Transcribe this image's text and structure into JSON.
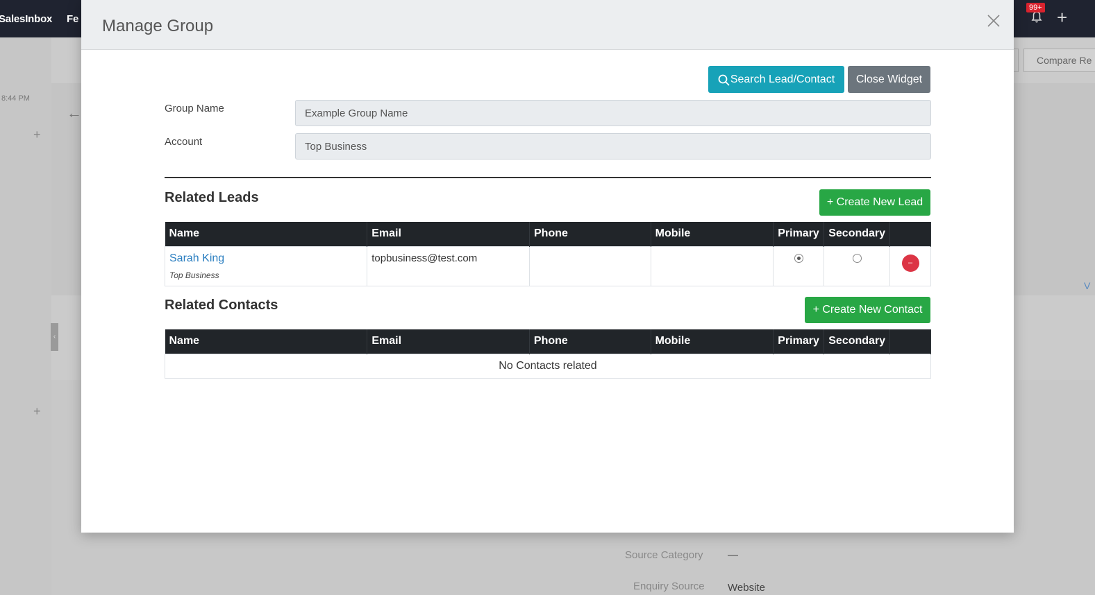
{
  "app": {
    "nav": [
      "SalesInbox",
      "Fe"
    ],
    "notification_badge": "99+",
    "background": {
      "time": "8:44 PM",
      "compare_button": "Compare Re",
      "edge_link": "V",
      "fields": [
        {
          "label": "Source Category",
          "value": "—"
        },
        {
          "label": "Enquiry Source",
          "value": "Website"
        }
      ]
    }
  },
  "modal": {
    "title": "Manage Group",
    "search_button": "Search Lead/Contact",
    "close_widget_button": "Close Widget",
    "group_name_label": "Group Name",
    "group_name_value": "Example Group Name",
    "account_label": "Account",
    "account_value": "Top Business",
    "leads": {
      "title": "Related Leads",
      "create_button": "+ Create New Lead",
      "columns": [
        "Name",
        "Email",
        "Phone",
        "Mobile",
        "Primary",
        "Secondary",
        ""
      ],
      "rows": [
        {
          "name": "Sarah King",
          "account": "Top Business",
          "email": "topbusiness@test.com",
          "phone": "",
          "mobile": "",
          "primary": true,
          "secondary": false,
          "remove_label": "–"
        }
      ]
    },
    "contacts": {
      "title": "Related Contacts",
      "create_button": "+ Create New Contact",
      "columns": [
        "Name",
        "Email",
        "Phone",
        "Mobile",
        "Primary",
        "Secondary",
        ""
      ],
      "empty_message": "No Contacts related"
    }
  },
  "colors": {
    "search_button": "#17a2b8",
    "close_widget_button": "#6c757d",
    "create_button": "#28a745",
    "table_header": "#212529",
    "link": "#2a7ec0",
    "remove": "#dc3545"
  }
}
